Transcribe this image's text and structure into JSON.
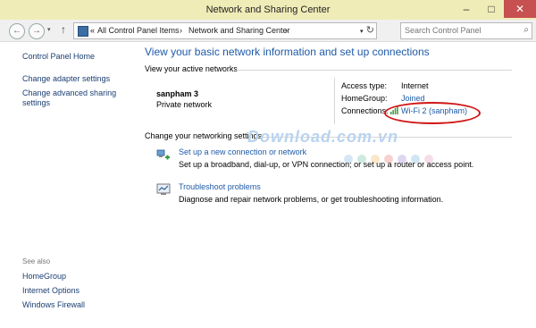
{
  "window": {
    "title": "Network and Sharing Center",
    "minimize": "–",
    "maximize": "□",
    "close": "✕"
  },
  "address": {
    "back": "←",
    "forward": "→",
    "up": "↑",
    "separator": "«",
    "crumbs": [
      "All Control Panel Items",
      "Network and Sharing Center"
    ],
    "arrows": [
      "›",
      "›"
    ],
    "refresh": "↻",
    "search_placeholder": "Search Control Panel",
    "search_icon": "search-icon"
  },
  "sidebar": {
    "home": "Control Panel Home",
    "items": [
      "Change adapter settings",
      "Change advanced sharing",
      "settings"
    ],
    "see_also_label": "See also",
    "see_also": [
      "HomeGroup",
      "Internet Options",
      "Windows Firewall"
    ]
  },
  "main": {
    "heading": "View your basic network information and set up connections",
    "active_networks_label": "View your active networks",
    "network": {
      "name": "sanpham  3",
      "type": "Private network",
      "access_type_label": "Access type:",
      "access_type_value": "Internet",
      "homegroup_label": "HomeGroup:",
      "homegroup_value": "Joined",
      "connections_label": "Connections:",
      "connections_value": "Wi-Fi 2 (sanpham)"
    },
    "change_settings_label": "Change your networking settings",
    "actions": [
      {
        "title": "Set up a new connection or network",
        "description": "Set up a broadband, dial-up, or VPN connection; or set up a router or access point.",
        "icon": "new-connection-icon"
      },
      {
        "title": "Troubleshoot problems",
        "description": "Diagnose and repair network problems, or get troubleshooting information.",
        "icon": "troubleshoot-icon"
      }
    ]
  },
  "watermark": "Download.com.vn",
  "colors": {
    "link": "#1e5aa8",
    "heading": "#1e5aa8",
    "titlebar": "#f0ecb8",
    "highlight_circle": "#d01515"
  }
}
